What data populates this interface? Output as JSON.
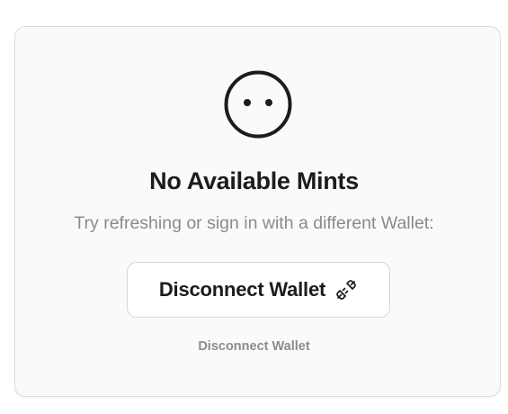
{
  "empty_state": {
    "icon": "neutral-face-icon",
    "title": "No Available Mints",
    "subtitle": "Try refreshing or sign in with a different Wallet:",
    "disconnect_button": {
      "label": "Disconnect Wallet",
      "icon": "plug-disconnect-icon"
    },
    "disconnect_link": "Disconnect Wallet"
  },
  "colors": {
    "text_primary": "#1c1c1c",
    "text_secondary": "#8a8a8a",
    "border": "#dcdcdc",
    "card_background": "#fafafa"
  }
}
